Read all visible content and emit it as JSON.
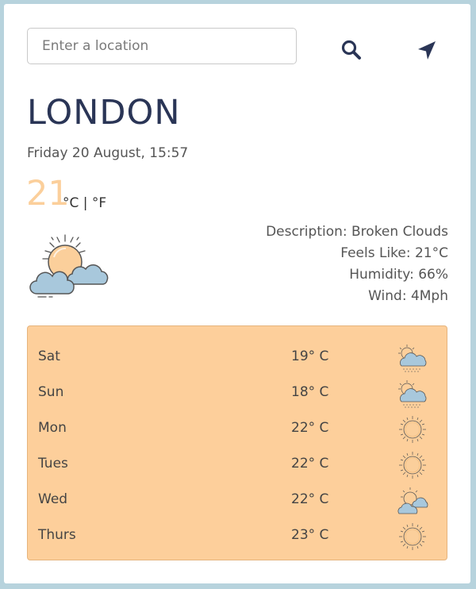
{
  "search": {
    "placeholder": "Enter a location"
  },
  "current": {
    "city": "LONDON",
    "datetime": "Friday 20 August, 15:57",
    "temperature": "21",
    "units": "°C | °F",
    "icon": "partly-cloudy-icon",
    "details": {
      "description": "Description: Broken Clouds",
      "feels_like": "Feels Like: 21°C",
      "humidity": "Humidity: 66%",
      "wind": "Wind: 4Mph"
    }
  },
  "forecast": [
    {
      "day": "Sat",
      "temp": "19° C",
      "icon": "rain-cloud-icon"
    },
    {
      "day": "Sun",
      "temp": "18° C",
      "icon": "rain-cloud-icon"
    },
    {
      "day": "Mon",
      "temp": "22° C",
      "icon": "sun-icon"
    },
    {
      "day": "Tues",
      "temp": "22° C",
      "icon": "sun-icon"
    },
    {
      "day": "Wed",
      "temp": "22° C",
      "icon": "partly-cloudy-icon"
    },
    {
      "day": "Thurs",
      "temp": "23° C",
      "icon": "sun-icon"
    }
  ],
  "colors": {
    "background": "#b7d3dd",
    "accent_temp": "#fbcf9b",
    "forecast_panel": "#fdcf9b",
    "heading": "#2a3556"
  }
}
